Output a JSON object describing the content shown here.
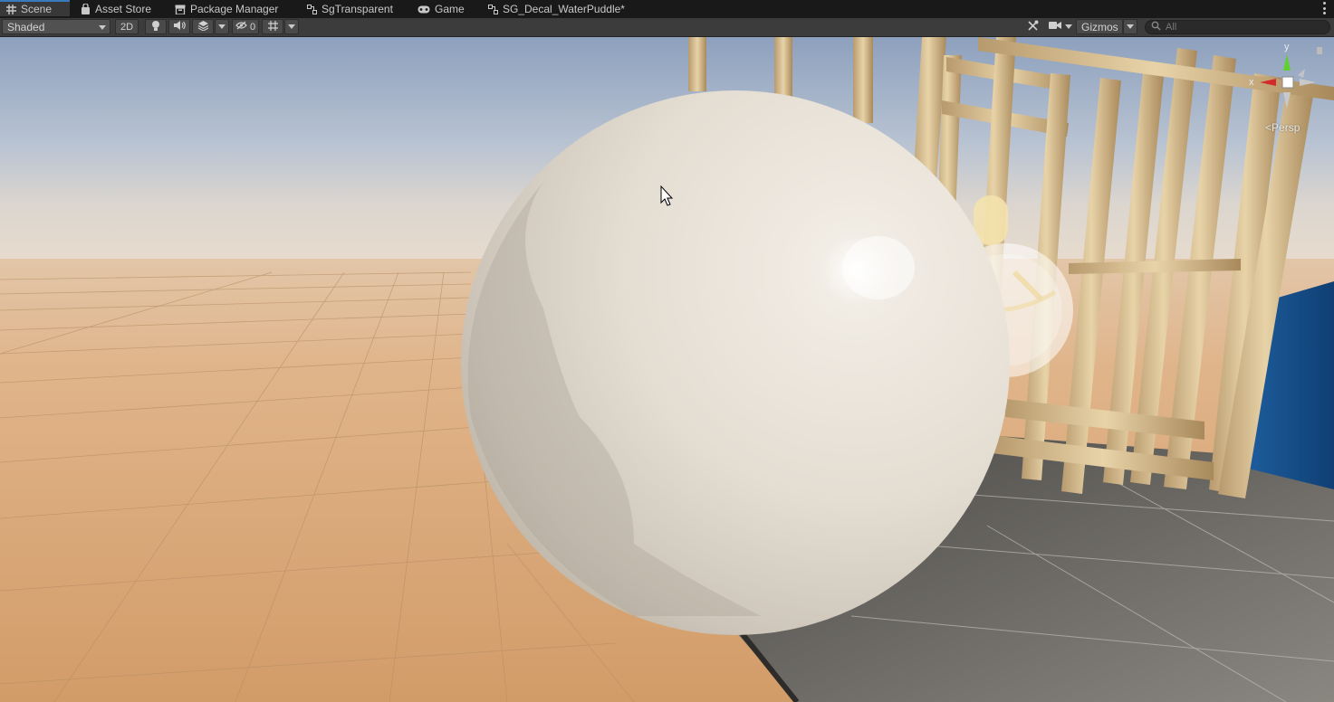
{
  "tabs": [
    {
      "label": "Scene",
      "icon": "grid-hash-icon",
      "active": true
    },
    {
      "label": "Asset Store",
      "icon": "shopping-bag-icon"
    },
    {
      "label": "Package Manager",
      "icon": "package-icon"
    },
    {
      "label": "SgTransparent",
      "icon": "shader-graph-icon"
    },
    {
      "label": "Game",
      "icon": "gamepad-icon"
    },
    {
      "label": "SG_Decal_WaterPuddle*",
      "icon": "shader-graph-icon"
    }
  ],
  "toolbar": {
    "shading_mode": "Shaded",
    "twod_label": "2D",
    "hidden_count": "0",
    "gizmos_label": "Gizmos",
    "search_placeholder": "All"
  },
  "scene": {
    "projection_label": "Persp",
    "axis_y": "y",
    "axis_x": "x"
  },
  "colors": {
    "axis_x": "#d42b2b",
    "axis_y": "#5fd12b",
    "tab_accent": "#3a79bb",
    "sphere": "#e8e2d8",
    "ground": "#d6a373"
  }
}
